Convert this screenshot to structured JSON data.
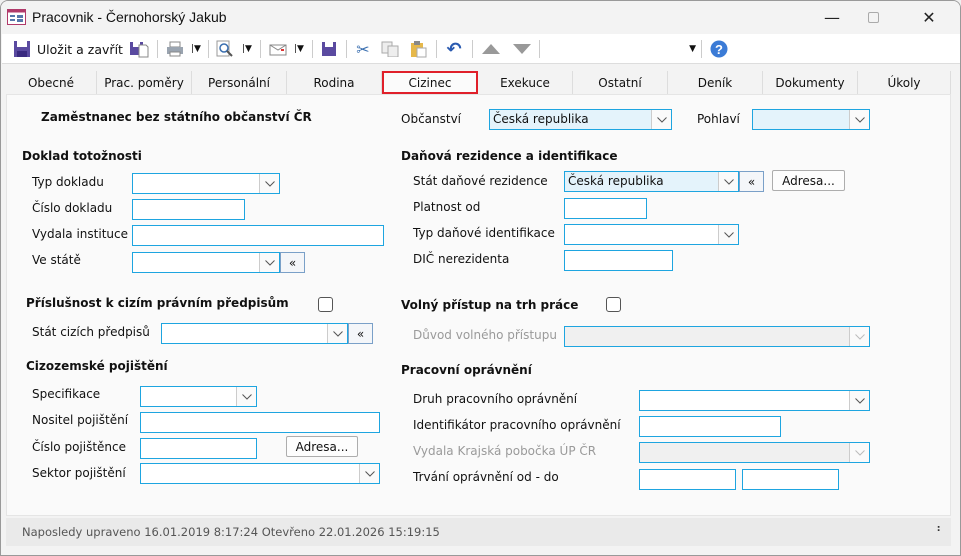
{
  "window": {
    "title": "Pracovnik - Černohorský Jakub",
    "minimize_icon": "minimize-icon",
    "maximize_icon": "maximize-icon",
    "close_icon": "close-icon"
  },
  "toolbar": {
    "save_close_label": "Uložit a zavřít",
    "combo_value": ""
  },
  "tabs": [
    {
      "label": "Obecné"
    },
    {
      "label": "Prac. poměry"
    },
    {
      "label": "Personální"
    },
    {
      "label": "Rodina"
    },
    {
      "label": "Cizinec",
      "active": true
    },
    {
      "label": "Exekuce"
    },
    {
      "label": "Ostatní"
    },
    {
      "label": "Deník"
    },
    {
      "label": "Dokumenty"
    },
    {
      "label": "Úkoly"
    }
  ],
  "form": {
    "stateless_label": "Zaměstnanec bez státního občanství ČR",
    "citizenship": {
      "label": "Občanství",
      "value": "Česká republika"
    },
    "gender": {
      "label": "Pohlaví",
      "value": ""
    },
    "id_doc": {
      "heading": "Doklad totožnosti",
      "type_label": "Typ dokladu",
      "number_label": "Číslo dokladu",
      "issuer_label": "Vydala instituce",
      "country_label": "Ve státě"
    },
    "foreign_law": {
      "heading": "Příslušnost k cizím právním předpisům",
      "checked": false,
      "country_label": "Stát cizích předpisů"
    },
    "insurance": {
      "heading": "Cizozemské pojištění",
      "spec_label": "Specifikace",
      "holder_label": "Nositel pojištění",
      "number_label": "Číslo pojištěnce",
      "address_button": "Adresa...",
      "sector_label": "Sektor pojištění"
    },
    "tax": {
      "heading": "Daňová rezidence a identifikace",
      "country_label": "Stát daňové rezidence",
      "country_value": "Česká republika",
      "address_button": "Adresa...",
      "valid_from_label": "Platnost od",
      "id_type_label": "Typ daňové identifikace",
      "dic_label": "DIČ nerezidenta"
    },
    "labor_access": {
      "heading": "Volný přístup na trh práce",
      "checked": false,
      "reason_label": "Důvod volného přístupu"
    },
    "work_permit": {
      "heading": "Pracovní oprávnění",
      "type_label": "Druh pracovního oprávnění",
      "id_label": "Identifikátor pracovního oprávnění",
      "office_label": "Vydala Krajská pobočka ÚP ČR",
      "duration_label": "Trvání oprávnění od - do"
    },
    "pick_button": "«"
  },
  "status": {
    "text": "Naposledy upraveno 16.01.2019 8:17:24 Otevřeno 22.01.2026 15:19:15",
    "grip": "⠃"
  },
  "colors": {
    "field_border": "#1ea5e0",
    "selected_field": "#e4f3fb",
    "active_tab_border": "#e0202a"
  }
}
